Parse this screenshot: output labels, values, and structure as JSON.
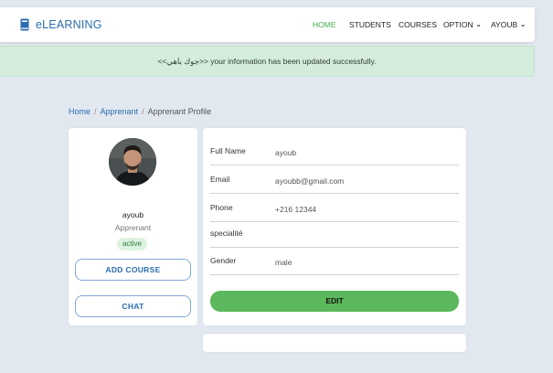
{
  "navbar": {
    "brand": "eLEARNING",
    "items": [
      "HOME",
      "STUDENTS",
      "COURSES",
      "OPTION",
      "AYOUB"
    ],
    "active_color": "#3fb24a",
    "brand_color": "#2b6cb0"
  },
  "alert": {
    "message": "<<جوك باهي>> your information has been updated successfully."
  },
  "breadcrumb": {
    "home": "Home",
    "apprenant": "Apprenant",
    "current": "Apprenant Profile"
  },
  "profile": {
    "name": "ayoub",
    "role": "Apprenant",
    "status": "active",
    "add_course_label": "ADD COURSE",
    "chat_label": "CHAT"
  },
  "details": {
    "rows": [
      {
        "label": "Full Name",
        "value": "ayoub"
      },
      {
        "label": "Email",
        "value": "ayoubb@gmail.com"
      },
      {
        "label": "Phone",
        "value": "+216 12344"
      },
      {
        "label": "specialité",
        "value": ""
      },
      {
        "label": "Gender",
        "value": "male"
      }
    ],
    "edit_label": "EDIT"
  }
}
